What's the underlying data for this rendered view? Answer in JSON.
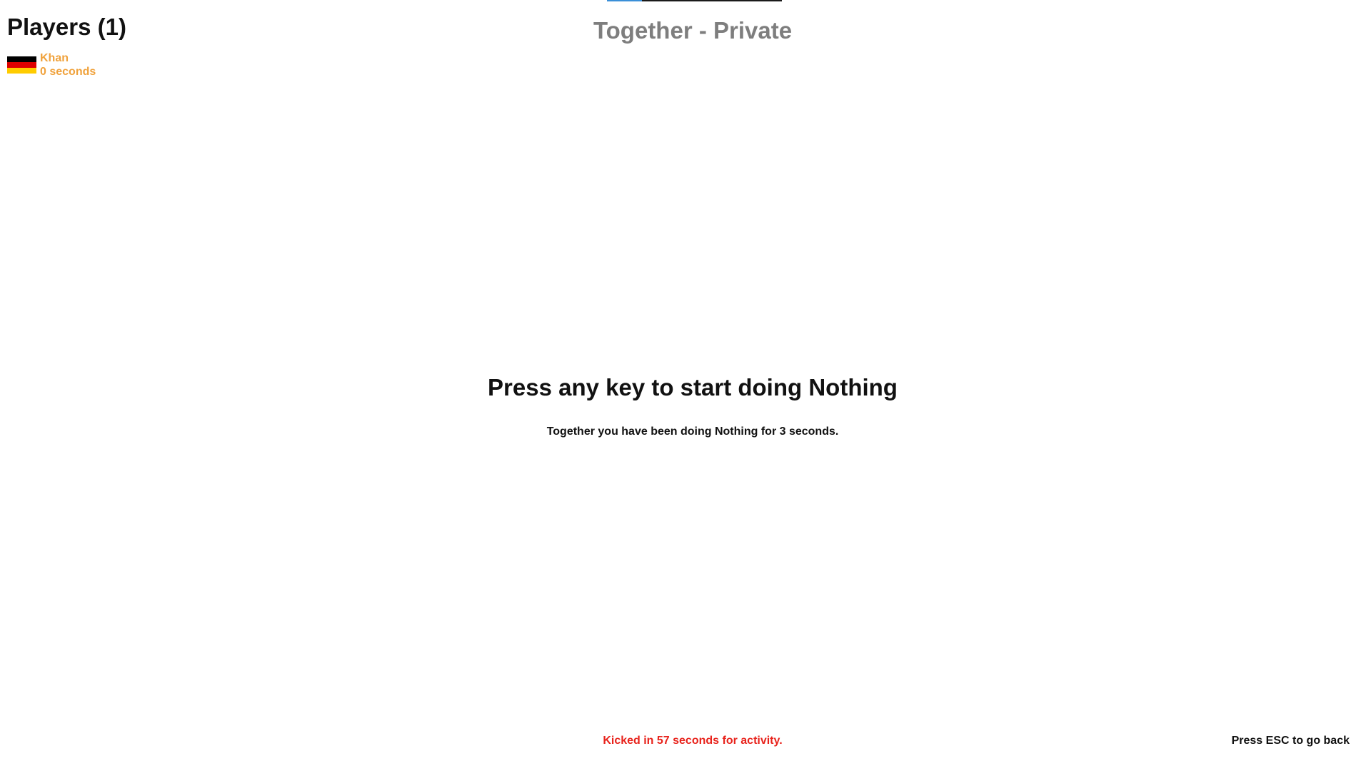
{
  "top_progress": {
    "fraction": 0.2,
    "fill_color": "#3a8fd8",
    "track_color": "#1a1a1a"
  },
  "players": {
    "heading": "Players (1)",
    "list": [
      {
        "name": "Khan",
        "time": "0 seconds",
        "flag": "germany-flag-icon",
        "color": "#f0a23c",
        "flag_colors": [
          "#000000",
          "#dd0000",
          "#ffcc00"
        ]
      }
    ]
  },
  "room": {
    "title": "Together - Private"
  },
  "prompt": {
    "heading": "Press any key to start doing Nothing",
    "subtext": "Together you have been doing Nothing for 3 seconds."
  },
  "footer": {
    "kick_warning": "Kicked in 57 seconds for activity.",
    "kick_color": "#e8231c",
    "esc_hint": "Press ESC to go back"
  }
}
